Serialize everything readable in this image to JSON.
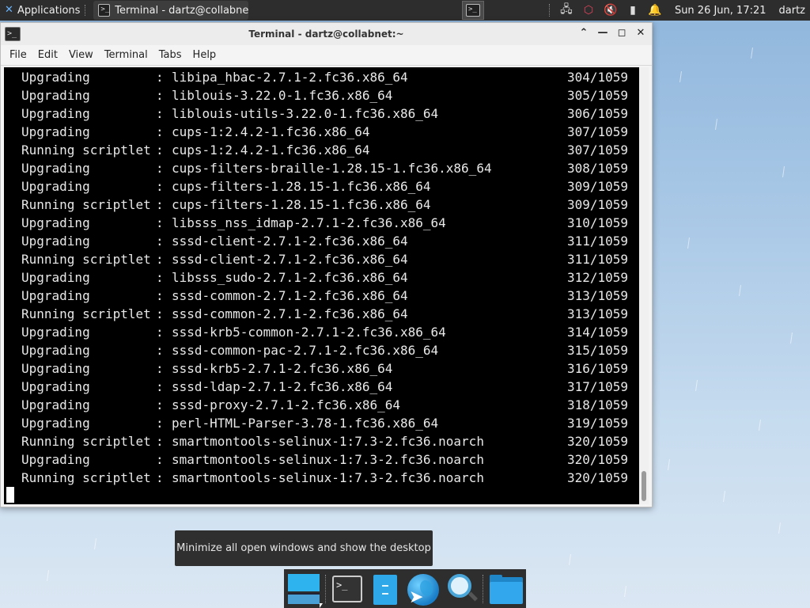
{
  "top_panel": {
    "apps_label": "Applications",
    "task_title": "Terminal - dartz@collabne...",
    "clock": "Sun 26 Jun, 17:21",
    "user": "dartz"
  },
  "window": {
    "title": "Terminal - dartz@collabnet:~",
    "controls": {
      "up": "⌃",
      "minimize": "—",
      "maximize": "◻",
      "close": "✕"
    },
    "menu": [
      "File",
      "Edit",
      "View",
      "Terminal",
      "Tabs",
      "Help"
    ]
  },
  "terminal": {
    "lines": [
      {
        "action": "Upgrading",
        "package": "libipa_hbac-2.7.1-2.fc36.x86_64",
        "progress": "304/1059"
      },
      {
        "action": "Upgrading",
        "package": "liblouis-3.22.0-1.fc36.x86_64",
        "progress": "305/1059"
      },
      {
        "action": "Upgrading",
        "package": "liblouis-utils-3.22.0-1.fc36.x86_64",
        "progress": "306/1059"
      },
      {
        "action": "Upgrading",
        "package": "cups-1:2.4.2-1.fc36.x86_64",
        "progress": "307/1059"
      },
      {
        "action": "Running scriptlet",
        "package": "cups-1:2.4.2-1.fc36.x86_64",
        "progress": "307/1059"
      },
      {
        "action": "Upgrading",
        "package": "cups-filters-braille-1.28.15-1.fc36.x86_64",
        "progress": "308/1059"
      },
      {
        "action": "Upgrading",
        "package": "cups-filters-1.28.15-1.fc36.x86_64",
        "progress": "309/1059"
      },
      {
        "action": "Running scriptlet",
        "package": "cups-filters-1.28.15-1.fc36.x86_64",
        "progress": "309/1059"
      },
      {
        "action": "Upgrading",
        "package": "libsss_nss_idmap-2.7.1-2.fc36.x86_64",
        "progress": "310/1059"
      },
      {
        "action": "Upgrading",
        "package": "sssd-client-2.7.1-2.fc36.x86_64",
        "progress": "311/1059"
      },
      {
        "action": "Running scriptlet",
        "package": "sssd-client-2.7.1-2.fc36.x86_64",
        "progress": "311/1059"
      },
      {
        "action": "Upgrading",
        "package": "libsss_sudo-2.7.1-2.fc36.x86_64",
        "progress": "312/1059"
      },
      {
        "action": "Upgrading",
        "package": "sssd-common-2.7.1-2.fc36.x86_64",
        "progress": "313/1059"
      },
      {
        "action": "Running scriptlet",
        "package": "sssd-common-2.7.1-2.fc36.x86_64",
        "progress": "313/1059"
      },
      {
        "action": "Upgrading",
        "package": "sssd-krb5-common-2.7.1-2.fc36.x86_64",
        "progress": "314/1059"
      },
      {
        "action": "Upgrading",
        "package": "sssd-common-pac-2.7.1-2.fc36.x86_64",
        "progress": "315/1059"
      },
      {
        "action": "Upgrading",
        "package": "sssd-krb5-2.7.1-2.fc36.x86_64",
        "progress": "316/1059"
      },
      {
        "action": "Upgrading",
        "package": "sssd-ldap-2.7.1-2.fc36.x86_64",
        "progress": "317/1059"
      },
      {
        "action": "Upgrading",
        "package": "sssd-proxy-2.7.1-2.fc36.x86_64",
        "progress": "318/1059"
      },
      {
        "action": "Upgrading",
        "package": "perl-HTML-Parser-3.78-1.fc36.x86_64",
        "progress": "319/1059"
      },
      {
        "action": "Running scriptlet",
        "package": "smartmontools-selinux-1:7.3-2.fc36.noarch",
        "progress": "320/1059"
      },
      {
        "action": "Upgrading",
        "package": "smartmontools-selinux-1:7.3-2.fc36.noarch",
        "progress": "320/1059"
      },
      {
        "action": "Running scriptlet",
        "package": "smartmontools-selinux-1:7.3-2.fc36.noarch",
        "progress": "320/1059"
      }
    ]
  },
  "tooltip": "Minimize all open windows and show the desktop",
  "dock": {
    "items": [
      "show-desktop",
      "terminal",
      "text-editor",
      "web-browser",
      "app-finder",
      "file-manager"
    ]
  }
}
